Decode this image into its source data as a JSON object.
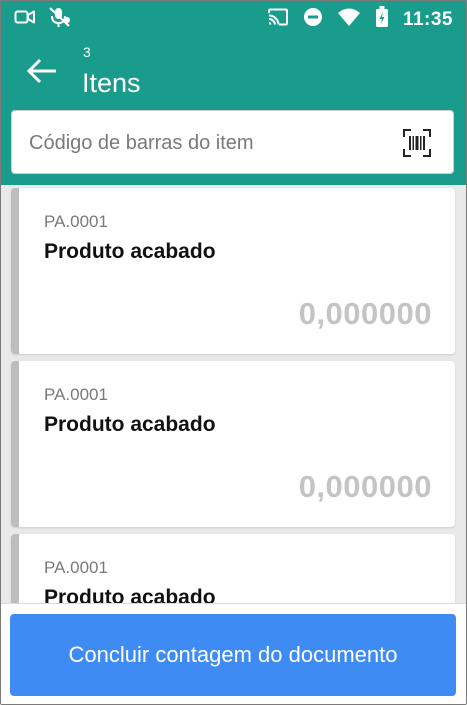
{
  "status_bar": {
    "time": "11:35",
    "left_icons": [
      "video-call-icon",
      "mic-off-icon"
    ],
    "right_icons": [
      "cast-icon",
      "do-not-disturb-icon",
      "wifi-icon",
      "battery-icon"
    ]
  },
  "header": {
    "count": "3",
    "title": "Itens",
    "back_icon": "arrow-left-icon"
  },
  "search": {
    "placeholder": "Código de barras do item",
    "value": "",
    "scan_icon": "barcode-scan-icon"
  },
  "items": [
    {
      "code": "PA.0001",
      "name": "Produto acabado",
      "quantity": "0,000000"
    },
    {
      "code": "PA.0001",
      "name": "Produto acabado",
      "quantity": "0,000000"
    },
    {
      "code": "PA.0001",
      "name": "Produto acabado",
      "quantity": ""
    }
  ],
  "footer": {
    "button_label": "Concluir contagem do documento"
  },
  "colors": {
    "header_bg": "#1a9c8c",
    "primary_button": "#3d8bf3",
    "list_bg": "#e9e9e9",
    "card_accent": "#bdbdbd"
  }
}
